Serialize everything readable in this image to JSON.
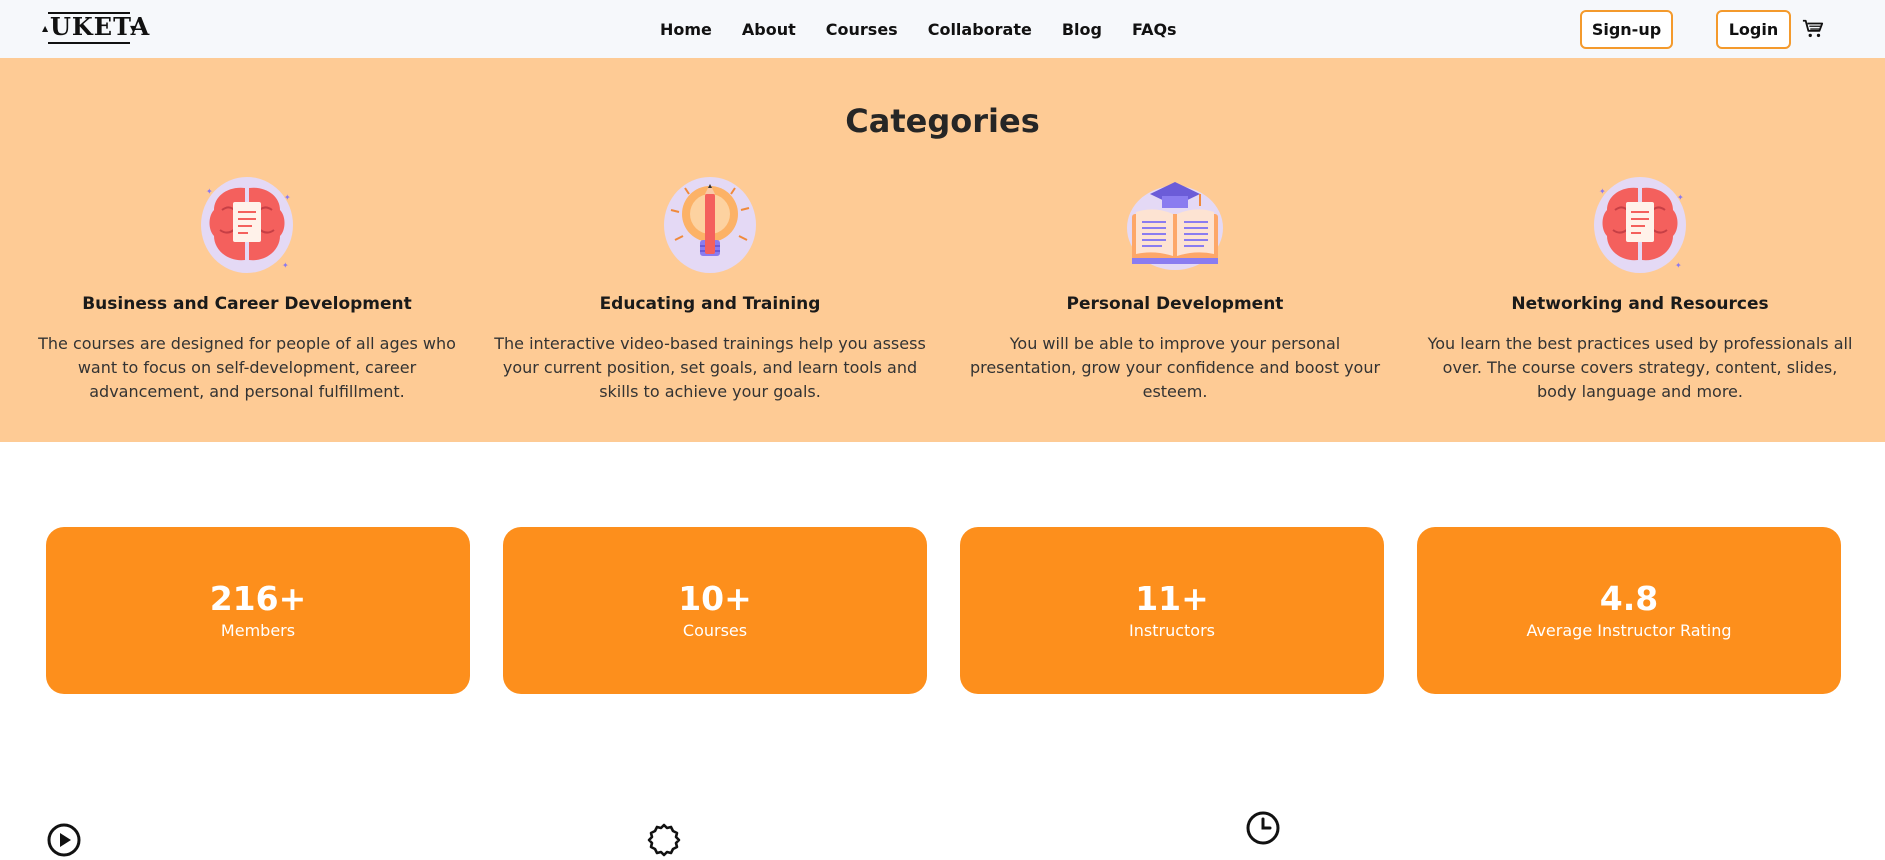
{
  "brand": {
    "logo_text": "UKETA"
  },
  "nav": {
    "links": [
      "Home",
      "About",
      "Courses",
      "Collaborate",
      "Blog",
      "FAQs"
    ],
    "signup_label": "Sign-up",
    "login_label": "Login",
    "cart_icon": "cart-icon"
  },
  "categories": {
    "title": "Categories",
    "items": [
      {
        "name": "Business and Career Development",
        "description": "The courses are designed for people of all ages who want to focus on self-development, career advancement, and personal fulfillment.",
        "icon": "brain-icon"
      },
      {
        "name": "Educating and Training",
        "description": "The interactive video-based trainings help you assess your current position, set goals, and learn tools and skills to achieve your goals.",
        "icon": "lightbulb-pencil-icon"
      },
      {
        "name": "Personal Development",
        "description": "You will be able to improve your personal presentation, grow your confidence and boost your esteem.",
        "icon": "book-graduation-cap-icon"
      },
      {
        "name": "Networking and Resources",
        "description": "You learn the best practices used by professionals all over. The course covers strategy, content, slides, body language and more.",
        "icon": "brain-icon"
      }
    ]
  },
  "stats": [
    {
      "value": "216+",
      "label": "Members"
    },
    {
      "value": "10+",
      "label": "Courses"
    },
    {
      "value": "11+",
      "label": "Instructors"
    },
    {
      "value": "4.8",
      "label": "Average Instructor Rating"
    }
  ],
  "features": {
    "icons": [
      "play-circle-icon",
      "badge-icon",
      "clock-icon"
    ]
  },
  "colors": {
    "accent": "#fd8f1c",
    "categories_bg": "#fecb95",
    "button_border": "#f49a2c",
    "nav_bg": "#f6f8fb"
  }
}
